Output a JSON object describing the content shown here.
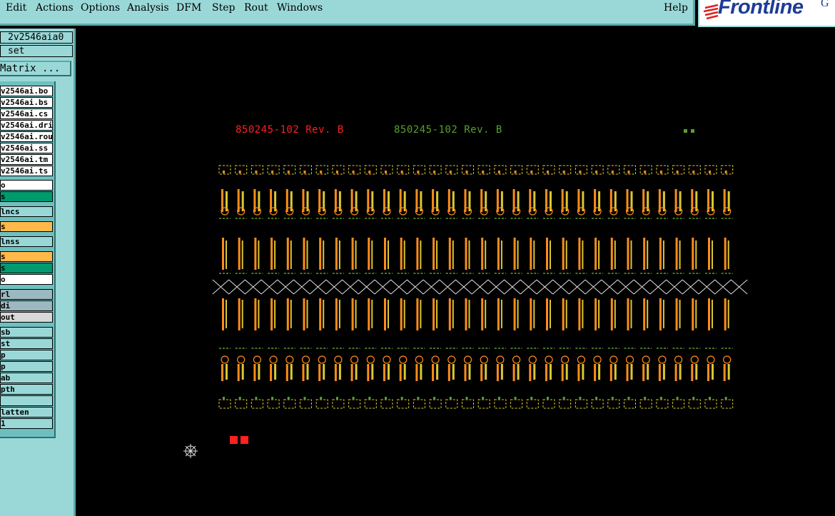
{
  "menubar": {
    "items": [
      "Edit",
      "Actions",
      "Options",
      "Analysis",
      "DFM",
      "Step",
      "Rout",
      "Windows"
    ],
    "help": "Help"
  },
  "logo": {
    "text": "Frontline",
    "sup": "G"
  },
  "sidebar": {
    "job_field": "2v2546aia0",
    "step_field": "set",
    "matrix_button": "Matrix ...",
    "layers": [
      {
        "label": "v2546ai.bo",
        "color": "#ffffff"
      },
      {
        "label": "v2546ai.bs",
        "color": "#ffffff"
      },
      {
        "label": "v2546ai.cs",
        "color": "#ffffff"
      },
      {
        "label": "v2546ai.dri",
        "color": "#ffffff"
      },
      {
        "label": "v2546ai.rou",
        "color": "#ffffff"
      },
      {
        "label": "v2546ai.ss",
        "color": "#ffffff"
      },
      {
        "label": "v2546ai.tm",
        "color": "#ffffff"
      },
      {
        "label": "v2546ai.ts",
        "color": "#ffffff"
      },
      {
        "label": "o",
        "color": "#ffffff"
      },
      {
        "label": "s",
        "color": "#009a6e"
      },
      {
        "label": "lncs",
        "color": "#9ad8d8"
      },
      {
        "label": "s",
        "color": "#ffb84a"
      },
      {
        "label": "lnss",
        "color": "#9ad8d8"
      },
      {
        "label": "s",
        "color": "#ffb84a"
      },
      {
        "label": "s",
        "color": "#009a6e"
      },
      {
        "label": "o",
        "color": "#ffffff"
      },
      {
        "label": "rl",
        "color": "#9cb8c0"
      },
      {
        "label": "di",
        "color": "#9cb8c0"
      },
      {
        "label": "out",
        "color": "#d8d8d8"
      },
      {
        "label": "sb",
        "color": "#9ad8d8"
      },
      {
        "label": "st",
        "color": "#9ad8d8"
      },
      {
        "label": "p",
        "color": "#9ad8d8"
      },
      {
        "label": "p",
        "color": "#9ad8d8"
      },
      {
        "label": "ab",
        "color": "#9ad8d8"
      },
      {
        "label": "pth",
        "color": "#9ad8d8"
      },
      {
        "label": "",
        "color": "#9ad8d8"
      },
      {
        "label": "latten",
        "color": "#9ad8d8"
      },
      {
        "label": "1",
        "color": "#9ad8d8"
      }
    ]
  },
  "canvas": {
    "rev_label_red": "850245-102 Rev. B",
    "rev_label_green": "850245-102 Rev. B",
    "board_columns": 32,
    "colors": {
      "red": "#ff2020",
      "green": "#5aa02a",
      "orange": "#ff8c1a",
      "yellow": "#d8c830",
      "white": "#e0e0e0"
    }
  }
}
